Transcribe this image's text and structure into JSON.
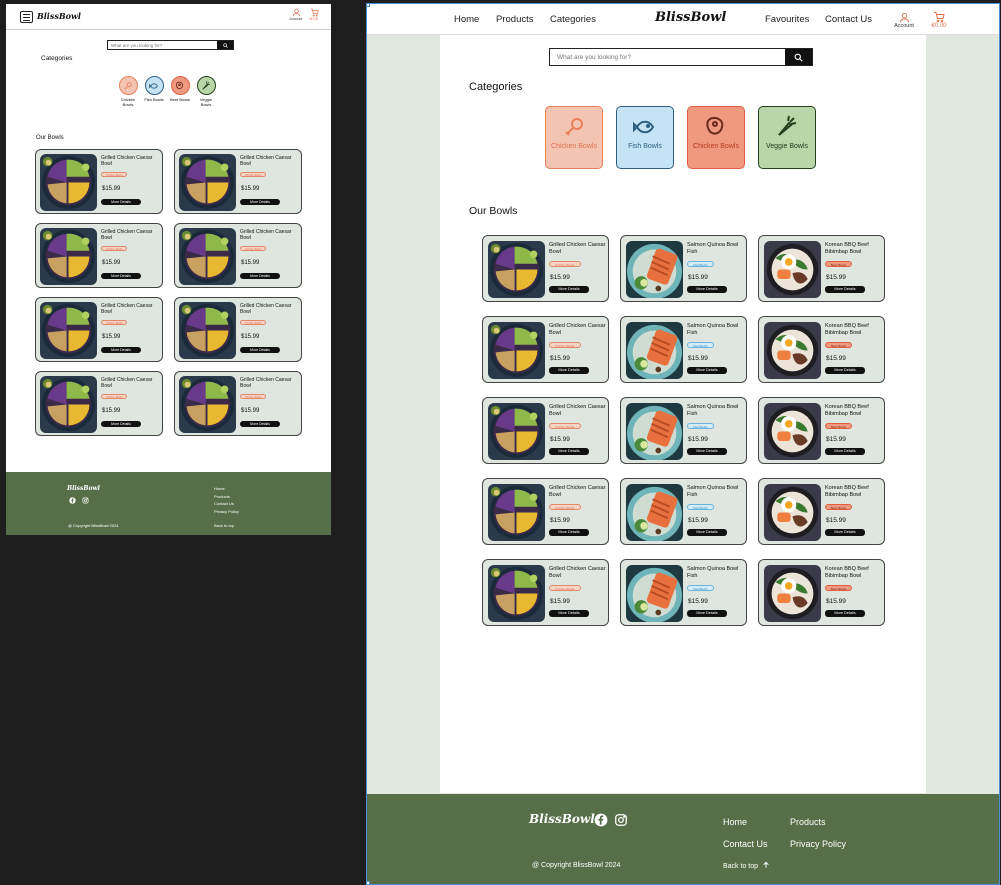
{
  "brand": {
    "logo": "BlissBowl"
  },
  "nav": {
    "items": [
      "Home",
      "Products",
      "Categories",
      "Favourites",
      "Contact Us"
    ],
    "account_label": "Account",
    "cart_total": "€0.00"
  },
  "search": {
    "placeholder": "What are you looking for?"
  },
  "categories": {
    "title": "Categories",
    "items": [
      {
        "label": "Chicken Bowls",
        "icon": "chicken-leg-icon",
        "color": "#e8805a",
        "bg": "#f4c4b2"
      },
      {
        "label": "Fish Bowls",
        "icon": "fish-icon",
        "color": "#2e5f80",
        "bg": "#c4e4f5"
      },
      {
        "label": "Chicken Bowls",
        "icon": "beef-icon",
        "color": "#e06040",
        "bg": "#ef9a80"
      },
      {
        "label": "Veggie Bowls",
        "icon": "carrot-icon",
        "color": "#22401c",
        "bg": "#b8d6a8"
      }
    ],
    "mobile_items": [
      {
        "label": "Chicken Bowls"
      },
      {
        "label": "Fish Bowls"
      },
      {
        "label": "Beef Bowls"
      },
      {
        "label": "Veggie Bowls"
      }
    ]
  },
  "bowls": {
    "title": "Our Bowls",
    "more_label": "More Details",
    "mobile_cards": [
      {
        "name": "Grilled Chicken Caesar Bowl",
        "price": "$15.99",
        "tag": "Chicken Bowls"
      },
      {
        "name": "Grilled Chicken Caesar Bowl",
        "price": "$15.99",
        "tag": "Chicken Bowls"
      },
      {
        "name": "Grilled Chicken Caesar Bowl",
        "price": "$15.99",
        "tag": "Chicken Bowls"
      },
      {
        "name": "Grilled Chicken Caesar Bowl",
        "price": "$15.99",
        "tag": "Chicken Bowls"
      },
      {
        "name": "Grilled Chicken Caesar Bowl",
        "price": "$15.99",
        "tag": "Chicken Bowls"
      },
      {
        "name": "Grilled Chicken Caesar Bowl",
        "price": "$15.99",
        "tag": "Chicken Bowls"
      },
      {
        "name": "Grilled Chicken Caesar Bowl",
        "price": "$15.99",
        "tag": "Chicken Bowls"
      },
      {
        "name": "Grilled Chicken Caesar Bowl",
        "price": "$15.99",
        "tag": "Chicken Bowls"
      }
    ],
    "desktop_rows": [
      [
        {
          "name": "Grilled Chicken Caesar Bowl",
          "price": "$15.99",
          "tag": "Chicken Bowls",
          "kind": "chicken"
        },
        {
          "name": "Salmon Quinoa Bowl Fish",
          "price": "$15.99",
          "tag": "Fish Bowls",
          "kind": "salmon"
        },
        {
          "name": "Korean BBQ Beef Bibimbap Bowl",
          "price": "$15.99",
          "tag": "Beef Bowls",
          "kind": "beef"
        }
      ],
      [
        {
          "name": "Grilled Chicken Caesar Bowl",
          "price": "$15.99",
          "tag": "Chicken Bowls",
          "kind": "chicken"
        },
        {
          "name": "Salmon Quinoa Bowl Fish",
          "price": "$15.99",
          "tag": "Fish Bowls",
          "kind": "salmon"
        },
        {
          "name": "Korean BBQ Beef Bibimbap Bowl",
          "price": "$15.99",
          "tag": "Beef Bowls",
          "kind": "beef"
        }
      ],
      [
        {
          "name": "Grilled Chicken Caesar Bowl",
          "price": "$15.99",
          "tag": "Chicken Bowls",
          "kind": "chicken"
        },
        {
          "name": "Salmon Quinoa Bowl Fish",
          "price": "$15.99",
          "tag": "Fish Bowls",
          "kind": "salmon"
        },
        {
          "name": "Korean BBQ Beef Bibimbap Bowl",
          "price": "$15.99",
          "tag": "Beef Bowls",
          "kind": "beef"
        }
      ],
      [
        {
          "name": "Grilled Chicken Caesar Bowl",
          "price": "$15.99",
          "tag": "Chicken Bowls",
          "kind": "chicken"
        },
        {
          "name": "Salmon Quinoa Bowl Fish",
          "price": "$15.99",
          "tag": "Fish Bowls",
          "kind": "salmon"
        },
        {
          "name": "Korean BBQ Beef Bibimbap Bowl",
          "price": "$15.99",
          "tag": "Beef Bowls",
          "kind": "beef"
        }
      ],
      [
        {
          "name": "Grilled Chicken Caesar Bowl",
          "price": "$15.99",
          "tag": "Chicken Bowls",
          "kind": "chicken"
        },
        {
          "name": "Salmon Quinoa Bowl Fish",
          "price": "$15.99",
          "tag": "Fish Bowls",
          "kind": "salmon"
        },
        {
          "name": "Korean BBQ Beef Bibimbap Bowl",
          "price": "$15.99",
          "tag": "Beef Bowls",
          "kind": "beef"
        }
      ]
    ]
  },
  "footer": {
    "links": [
      "Home",
      "Products",
      "Contact Us",
      "Privacy Policy"
    ],
    "copyright": "@ Copyright BlissBowl 2024",
    "back_to_top": "Back to top",
    "social": [
      "facebook-icon",
      "instagram-icon"
    ]
  },
  "colors": {
    "footer_bg": "#566f48",
    "accent": "#e07050",
    "page_bg": "#e1e8e0",
    "card_bg": "#dfe6df"
  }
}
